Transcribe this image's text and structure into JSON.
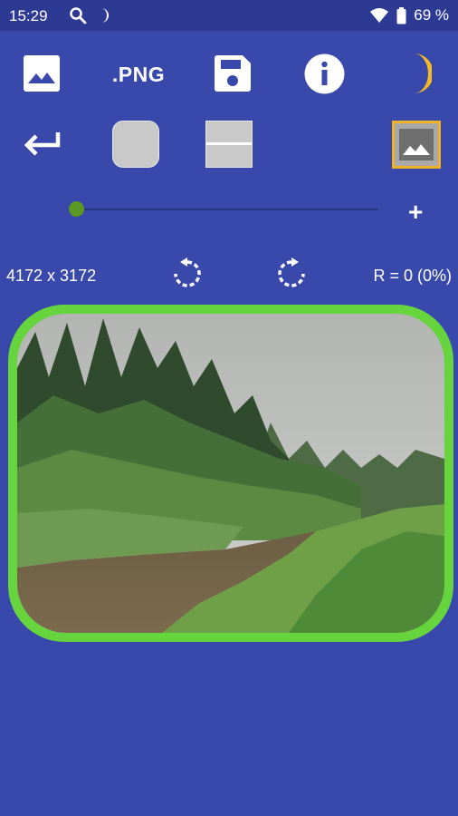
{
  "status_bar": {
    "time": "15:29",
    "battery": "69 %",
    "icons": [
      "search-icon",
      "moon-icon",
      "wifi-icon",
      "battery-icon"
    ]
  },
  "toolbar": {
    "format_label": ".PNG",
    "icons": [
      "image-icon",
      "save-icon",
      "info-icon",
      "moon-icon"
    ]
  },
  "shape_row": {
    "icons": [
      "back-arrow-icon",
      "rounded-square-icon",
      "split-square-icon",
      "image-selected-icon"
    ],
    "accent_color": "#f0b323"
  },
  "slider": {
    "value": 0,
    "plus_label": "+"
  },
  "info": {
    "dimensions": "4172 x 3172",
    "radius": "R = 0 (0%)"
  },
  "colors": {
    "background": "#3949ab",
    "status_bar": "#2c3a93",
    "frame": "#66d43d",
    "slider_thumb": "#5a9a23"
  }
}
